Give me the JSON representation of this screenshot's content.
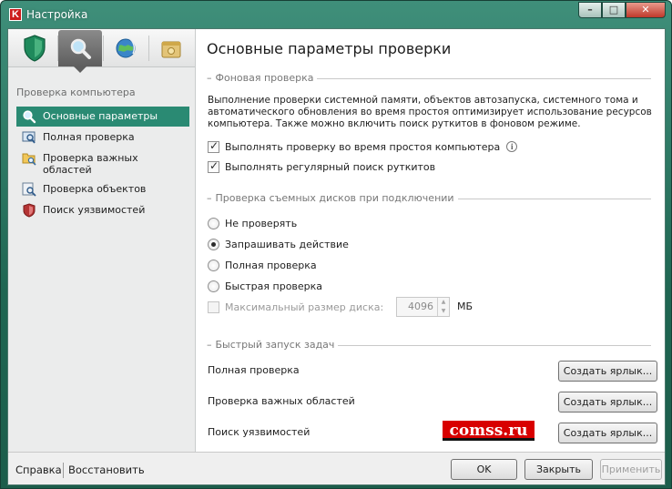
{
  "window": {
    "title": "Настройка",
    "app_icon_letter": "K",
    "minimize": "–",
    "maximize": "□",
    "close": "✕"
  },
  "toolbar_icons": [
    {
      "name": "protection-shield-icon",
      "active": false
    },
    {
      "name": "scan-magnifier-icon",
      "active": true
    },
    {
      "name": "update-globe-icon",
      "active": false
    },
    {
      "name": "settings-box-icon",
      "active": false
    }
  ],
  "sidebar": {
    "section_label": "Проверка компьютера",
    "items": [
      {
        "label": "Основные параметры",
        "icon": "magnifier-icon",
        "active": true
      },
      {
        "label": "Полная проверка",
        "icon": "monitor-scan-icon",
        "active": false
      },
      {
        "label": "Проверка важных областей",
        "icon": "folder-scan-icon",
        "active": false
      },
      {
        "label": "Проверка объектов",
        "icon": "objects-scan-icon",
        "active": false
      },
      {
        "label": "Поиск уязвимостей",
        "icon": "vulnerability-shield-icon",
        "active": false
      }
    ]
  },
  "main": {
    "heading": "Основные параметры проверки",
    "background_scan": {
      "title": "Фоновая проверка",
      "description": "Выполнение проверки системной памяти, объектов автозапуска, системного тома и автоматического обновления во время простоя оптимизирует использование ресурсов компьютера. Также можно включить поиск руткитов в фоновом режиме.",
      "idle_scan_label": "Выполнять проверку во время простоя компьютера",
      "idle_scan_checked": true,
      "rootkit_scan_label": "Выполнять регулярный поиск руткитов",
      "rootkit_scan_checked": true
    },
    "removable": {
      "title": "Проверка съемных дисков при подключении",
      "options": [
        "Не проверять",
        "Запрашивать действие",
        "Полная проверка",
        "Быстрая проверка"
      ],
      "selected_index": 1,
      "max_size_label": "Максимальный размер диска:",
      "max_size_checked": false,
      "max_size_value": "4096",
      "max_size_unit": "МБ"
    },
    "quick_launch": {
      "title": "Быстрый запуск задач",
      "tasks": [
        {
          "label": "Полная проверка",
          "button": "Создать ярлык..."
        },
        {
          "label": "Проверка важных областей",
          "button": "Создать ярлык..."
        },
        {
          "label": "Поиск уязвимостей",
          "button": "Создать ярлык..."
        }
      ]
    },
    "watermark": "comss.ru"
  },
  "footer": {
    "help": "Справка",
    "restore": "Восстановить",
    "ok": "OK",
    "close": "Закрыть",
    "apply": "Применить"
  }
}
